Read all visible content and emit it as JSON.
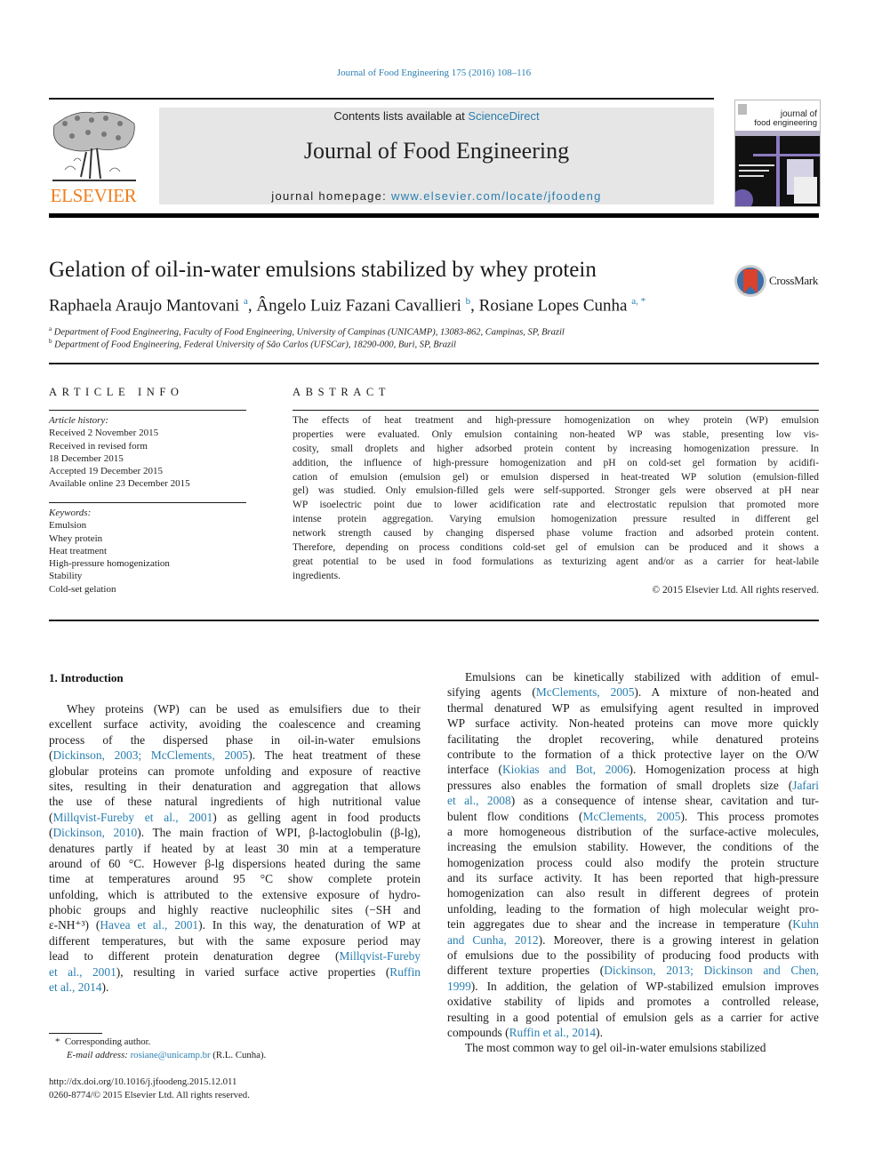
{
  "header": {
    "citation": "Journal of Food Engineering 175 (2016) 108–116",
    "contents_prefix": "Contents lists available at ",
    "contents_link": "ScienceDirect",
    "journal_title": "Journal of Food Engineering",
    "homepage_prefix": "journal homepage: ",
    "homepage_link": "www.elsevier.com/locate/jfoodeng",
    "publisher_logo_text": "ELSEVIER",
    "cover_title_line1": "journal of",
    "cover_title_line2": "food engineering",
    "colors": {
      "link": "#2a7fb0",
      "elsevier_orange": "#f07e1c",
      "banner_bg": "#e6e6e6"
    }
  },
  "article": {
    "title": "Gelation of oil-in-water emulsions stabilized by whey protein",
    "crossmark_label": "CrossMark",
    "authors": [
      {
        "name": "Raphaela Araujo Mantovani",
        "sup": "a"
      },
      {
        "name": "Ângelo Luiz Fazani Cavallieri",
        "sup": "b"
      },
      {
        "name": "Rosiane Lopes Cunha",
        "sup": "a, *"
      }
    ],
    "affiliations": [
      {
        "mark": "a",
        "text": "Department of Food Engineering, Faculty of Food Engineering, University of Campinas (UNICAMP), 13083-862, Campinas, SP, Brazil"
      },
      {
        "mark": "b",
        "text": "Department of Food Engineering, Federal University of São Carlos (UFSCar), 18290-000, Buri, SP, Brazil"
      }
    ]
  },
  "article_info": {
    "heading": "ARTICLE INFO",
    "history_label": "Article history:",
    "history": [
      "Received 2 November 2015",
      "Received in revised form",
      "18 December 2015",
      "Accepted 19 December 2015",
      "Available online 23 December 2015"
    ],
    "keywords_label": "Keywords:",
    "keywords": [
      "Emulsion",
      "Whey protein",
      "Heat treatment",
      "High-pressure homogenization",
      "Stability",
      "Cold-set gelation"
    ]
  },
  "abstract": {
    "heading": "ABSTRACT",
    "lines": [
      "The effects of heat treatment and high-pressure homogenization on whey protein (WP) emulsion",
      "properties were evaluated. Only emulsion containing non-heated WP was stable, presenting low vis-",
      "cosity, small droplets and higher adsorbed protein content by increasing homogenization pressure. In",
      "addition, the influence of high-pressure homogenization and pH on cold-set gel formation by acidifi-",
      "cation of emulsion (emulsion gel) or emulsion dispersed in heat-treated WP solution (emulsion-filled",
      "gel) was studied. Only emulsion-filled gels were self-supported. Stronger gels were observed at pH near",
      "WP isoelectric point due to lower acidification rate and electrostatic repulsion that promoted more",
      "intense protein aggregation. Varying emulsion homogenization pressure resulted in different gel",
      "network strength caused by changing dispersed phase volume fraction and adsorbed protein content.",
      "Therefore, depending on process conditions cold-set gel of emulsion can be produced and it shows a",
      "great potential to be used in food formulations as texturizing agent and/or as a carrier for heat-labile",
      "ingredients."
    ],
    "copyright": "© 2015 Elsevier Ltd. All rights reserved."
  },
  "body": {
    "section_heading": "1.  Introduction",
    "left_column": [
      [
        {
          "t": "Whey proteins (WP) can be used as emulsifiers due to their"
        }
      ],
      [
        {
          "t": "excellent surface activity, avoiding the coalescence and creaming"
        }
      ],
      [
        {
          "t": "process of the dispersed phase in oil-in-water emulsions"
        }
      ],
      [
        {
          "t": "(",
          "l": false
        },
        {
          "t": "Dickinson, 2003; McClements, 2005",
          "l": true
        },
        {
          "t": "). The heat treatment of these"
        }
      ],
      [
        {
          "t": "globular proteins can promote unfolding and exposure of reactive"
        }
      ],
      [
        {
          "t": "sites, resulting in their denaturation and aggregation that allows"
        }
      ],
      [
        {
          "t": "the use of these natural ingredients of high nutritional value"
        }
      ],
      [
        {
          "t": "("
        },
        {
          "t": "Millqvist-Fureby et al., 2001",
          "l": true
        },
        {
          "t": ") as gelling agent in food products"
        }
      ],
      [
        {
          "t": "("
        },
        {
          "t": "Dickinson, 2010",
          "l": true
        },
        {
          "t": "). The main fraction of WPI, β-lactoglobulin (β-lg),"
        }
      ],
      [
        {
          "t": "denatures partly if heated by at least 30 min at a temperature"
        }
      ],
      [
        {
          "t": "around of 60 °C. However β-lg dispersions heated during the same"
        }
      ],
      [
        {
          "t": "time at temperatures around 95 °C show complete protein"
        }
      ],
      [
        {
          "t": "unfolding, which is attributed to the extensive exposure of hydro-"
        }
      ],
      [
        {
          "t": "phobic groups and highly reactive nucleophilic sites (−SH and"
        }
      ],
      [
        {
          "t": "ε-NH⁺³) ("
        },
        {
          "t": "Havea et al., 2001",
          "l": true
        },
        {
          "t": "). In this way, the denaturation of WP at"
        }
      ],
      [
        {
          "t": "different temperatures, but with the same exposure period may"
        }
      ],
      [
        {
          "t": "lead to different protein denaturation degree ("
        },
        {
          "t": "Millqvist-Fureby",
          "l": true
        }
      ],
      [
        {
          "t": "et al., 2001",
          "l": true
        },
        {
          "t": "), resulting in varied surface active properties ("
        },
        {
          "t": "Ruffin",
          "l": true
        }
      ],
      [
        {
          "t": "et al., 2014",
          "l": true
        },
        {
          "t": ")."
        }
      ]
    ],
    "right_column": [
      [
        {
          "t": "Emulsions can be kinetically stabilized with addition of emul-"
        }
      ],
      [
        {
          "t": "sifying agents ("
        },
        {
          "t": "McClements, 2005",
          "l": true
        },
        {
          "t": "). A mixture of non-heated and"
        }
      ],
      [
        {
          "t": "thermal denatured WP as emulsifying agent resulted in improved"
        }
      ],
      [
        {
          "t": "WP surface activity. Non-heated proteins can move more quickly"
        }
      ],
      [
        {
          "t": "facilitating the droplet recovering, while denatured proteins"
        }
      ],
      [
        {
          "t": "contribute to the formation of a thick protective layer on the O/W"
        }
      ],
      [
        {
          "t": "interface ("
        },
        {
          "t": "Kiokias and Bot, 2006",
          "l": true
        },
        {
          "t": "). Homogenization process at high"
        }
      ],
      [
        {
          "t": "pressures also enables the formation of small droplets size ("
        },
        {
          "t": "Jafari",
          "l": true
        }
      ],
      [
        {
          "t": "et al., 2008",
          "l": true
        },
        {
          "t": ") as a consequence of intense shear, cavitation and tur-"
        }
      ],
      [
        {
          "t": "bulent flow conditions ("
        },
        {
          "t": "McClements, 2005",
          "l": true
        },
        {
          "t": "). This process promotes"
        }
      ],
      [
        {
          "t": "a more homogeneous distribution of the surface-active molecules,"
        }
      ],
      [
        {
          "t": "increasing the emulsion stability. However, the conditions of the"
        }
      ],
      [
        {
          "t": "homogenization process could also modify the protein structure"
        }
      ],
      [
        {
          "t": "and its surface activity. It has been reported that high-pressure"
        }
      ],
      [
        {
          "t": "homogenization can also result in different degrees of protein"
        }
      ],
      [
        {
          "t": "unfolding, leading to the formation of high molecular weight pro-"
        }
      ],
      [
        {
          "t": "tein aggregates due to shear and the increase in temperature ("
        },
        {
          "t": "Kuhn",
          "l": true
        }
      ],
      [
        {
          "t": "and Cunha, 2012",
          "l": true
        },
        {
          "t": "). Moreover, there is a growing interest in gelation"
        }
      ],
      [
        {
          "t": "of emulsions due to the possibility of producing food products with"
        }
      ],
      [
        {
          "t": "different texture properties ("
        },
        {
          "t": "Dickinson, 2013; Dickinson and Chen,",
          "l": true
        }
      ],
      [
        {
          "t": "1999",
          "l": true
        },
        {
          "t": "). In addition, the gelation of WP-stabilized emulsion improves"
        }
      ],
      [
        {
          "t": "oxidative stability of lipids and promotes a controlled release,"
        }
      ],
      [
        {
          "t": "resulting in a good potential of emulsion gels as a carrier for active"
        }
      ],
      [
        {
          "t": "compounds ("
        },
        {
          "t": "Ruffin et al., 2014",
          "l": true
        },
        {
          "t": ")."
        }
      ],
      [
        {
          "t": "The most common way to gel oil-in-water emulsions stabilized"
        }
      ]
    ]
  },
  "footnotes": {
    "corresponding_mark": "*",
    "corresponding_text": "Corresponding author.",
    "email_label": "E-mail address:",
    "email": "rosiane@unicamp.br",
    "email_suffix": " (R.L. Cunha).",
    "doi": "http://dx.doi.org/10.1016/j.jfoodeng.2015.12.011",
    "issn": "0260-8774/© 2015 Elsevier Ltd. All rights reserved."
  }
}
